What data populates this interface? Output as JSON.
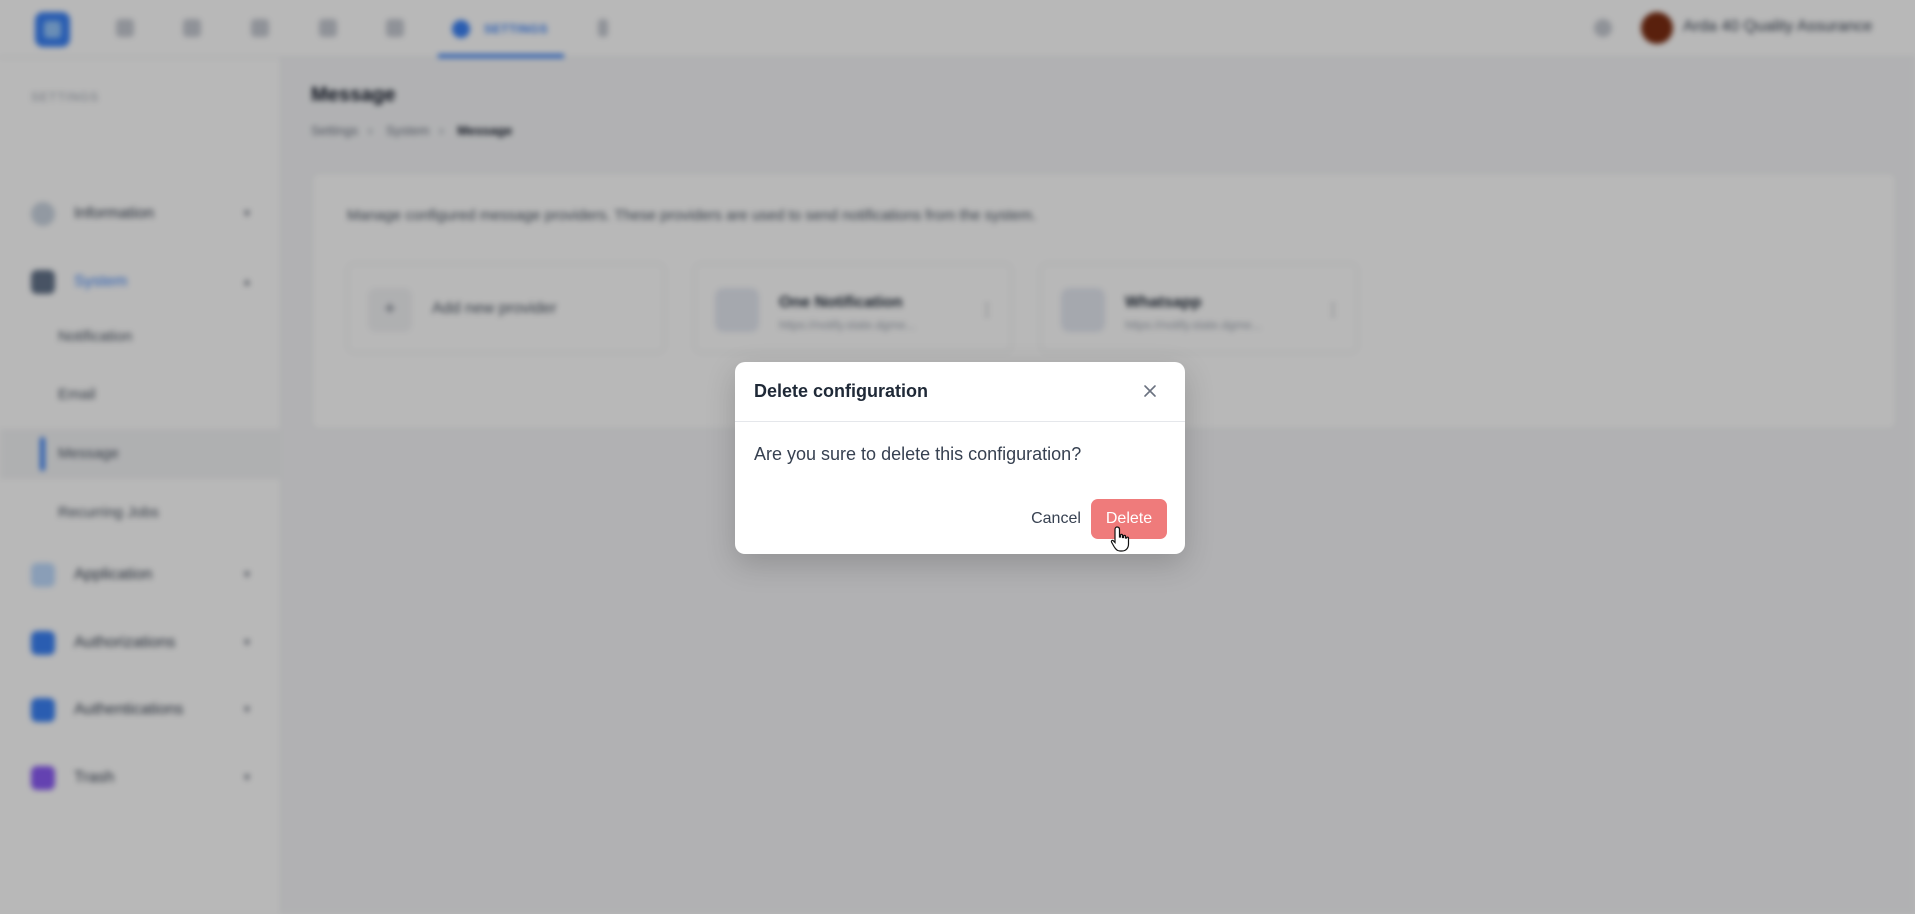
{
  "topbar": {
    "active_tab_label": "SETTINGS",
    "user_name": "Arda 40 Quality Assurance",
    "icons": [
      "home-icon",
      "user-icon",
      "document-icon",
      "bank-icon",
      "clock-icon",
      "settings-icon",
      "more-icon",
      "bell-icon"
    ]
  },
  "sidebar": {
    "heading": "SETTINGS",
    "items": [
      {
        "label": "Information",
        "icon": "info-icon"
      },
      {
        "label": "System",
        "icon": "system-icon",
        "active": true
      },
      {
        "label": "Application",
        "icon": "application-icon"
      },
      {
        "label": "Authorizations",
        "icon": "shield-icon"
      },
      {
        "label": "Authentications",
        "icon": "shield-icon"
      },
      {
        "label": "Trash",
        "icon": "trash-icon"
      }
    ],
    "subitems": [
      {
        "label": "Notification"
      },
      {
        "label": "Email"
      },
      {
        "label": "Message",
        "active": true
      },
      {
        "label": "Recurring Jobs"
      }
    ]
  },
  "main": {
    "title": "Message",
    "breadcrumb": [
      "Settings",
      "System",
      "Message"
    ],
    "description": "Manage configured message providers. These providers are used to send notifications from the system.",
    "add_card_label": "Add new provider",
    "providers": [
      {
        "name": "One Notification",
        "url": "https://notify.state.dgme..."
      },
      {
        "name": "Whatsapp",
        "url": "https://notify.state.dgme..."
      }
    ]
  },
  "modal": {
    "title": "Delete configuration",
    "message": "Are you sure to delete this configuration?",
    "cancel_label": "Cancel",
    "delete_label": "Delete",
    "delete_color": "#ef7b7b"
  }
}
